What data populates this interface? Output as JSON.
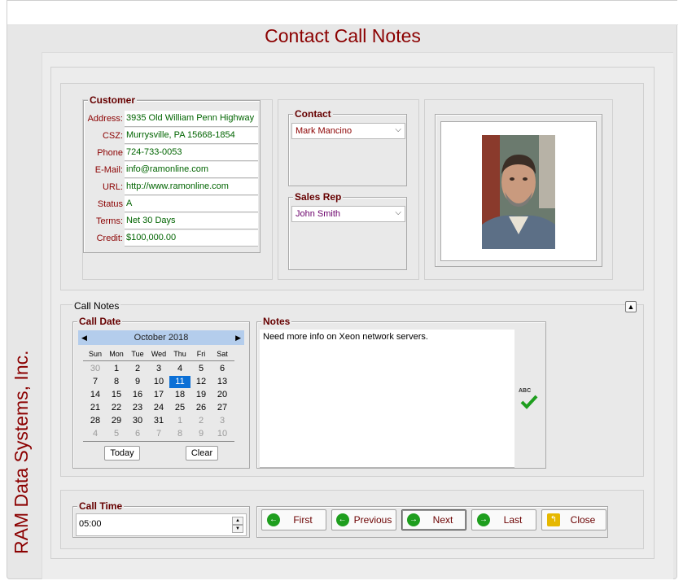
{
  "window": {
    "title": "Contact Call Notes",
    "sidebar_text": "RAM Data Systems, Inc."
  },
  "customer": {
    "group_title": "Customer",
    "fields": [
      {
        "label": "Address:",
        "value": "3935 Old William Penn Highway"
      },
      {
        "label": "CSZ:",
        "value": "Murrysville, PA 15668-1854"
      },
      {
        "label": "Phone",
        "value": "724-733-0053"
      },
      {
        "label": "E-Mail:",
        "value": "info@ramonline.com"
      },
      {
        "label": "URL:",
        "value": "http://www.ramonline.com"
      },
      {
        "label": "Status",
        "value": "A"
      },
      {
        "label": "Terms:",
        "value": "Net 30 Days"
      },
      {
        "label": "Credit:",
        "value": "$100,000.00"
      }
    ]
  },
  "contact": {
    "group_title": "Contact",
    "selected": "Mark Mancino"
  },
  "sales_rep": {
    "group_title": "Sales Rep",
    "selected": "John Smith"
  },
  "call_notes": {
    "section_label": "Call Notes"
  },
  "call_date": {
    "group_title": "Call Date",
    "month_label": "October 2018",
    "day_names": [
      "Sun",
      "Mon",
      "Tue",
      "Wed",
      "Thu",
      "Fri",
      "Sat"
    ],
    "weeks": [
      [
        "30",
        "1",
        "2",
        "3",
        "4",
        "5",
        "6"
      ],
      [
        "7",
        "8",
        "9",
        "10",
        "11",
        "12",
        "13"
      ],
      [
        "14",
        "15",
        "16",
        "17",
        "18",
        "19",
        "20"
      ],
      [
        "21",
        "22",
        "23",
        "24",
        "25",
        "26",
        "27"
      ],
      [
        "28",
        "29",
        "30",
        "31",
        "1",
        "2",
        "3"
      ],
      [
        "4",
        "5",
        "6",
        "7",
        "8",
        "9",
        "10"
      ]
    ],
    "selected_day": "11",
    "today_label": "Today",
    "clear_label": "Clear"
  },
  "notes": {
    "group_title": "Notes",
    "text": "Need more info on Xeon network servers."
  },
  "spellcheck": {
    "label": "ABC"
  },
  "call_time": {
    "group_title": "Call Time",
    "value": "05:00"
  },
  "nav": {
    "first_label": "First",
    "previous_label": "Previous",
    "next_label": "Next",
    "last_label": "Last",
    "close_label": "Close"
  },
  "colors": {
    "accent": "#8b0000",
    "value_text": "#006400",
    "calendar_header": "#b4cdec",
    "selection": "#0a6fd6"
  }
}
